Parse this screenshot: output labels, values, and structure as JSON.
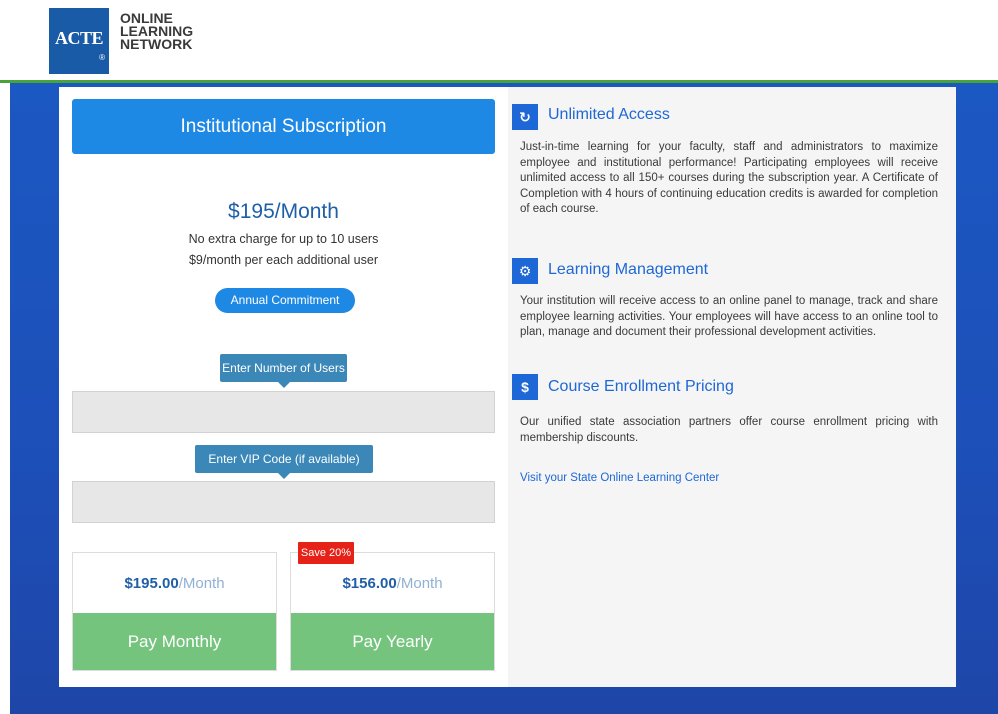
{
  "header": {
    "logo_brand": "ACTE",
    "logo_mark": "®",
    "logo_lines": [
      "ONLINE",
      "LEARNING",
      "NETWORK"
    ]
  },
  "subscription": {
    "title": "Institutional Subscription",
    "price": "$195/Month",
    "line1": "No extra charge for up to 10 users",
    "line2": "$9/month per each additional user",
    "commitment_label": "Annual Commitment",
    "users_label": "Enter Number of Users",
    "users_value": "",
    "vip_label": "Enter VIP Code (if available)",
    "vip_value": ""
  },
  "plans": [
    {
      "amount": "$195.00",
      "unit": "/Month",
      "button": "Pay Monthly"
    },
    {
      "amount": "$156.00",
      "unit": "/Month",
      "button": "Pay Yearly",
      "badge": "Save 20%"
    }
  ],
  "info": {
    "sections": [
      {
        "icon": "refresh-icon",
        "glyph": "↻",
        "title": "Unlimited Access",
        "body": "Just-in-time learning for your faculty, staff and administrators to maximize employee and institutional performance! Participating employees will receive unlimited access to all 150+ courses during the subscription year. A Certificate of Completion with 4 hours of continuing education credits is awarded for completion of each course."
      },
      {
        "icon": "gears-icon",
        "glyph": "⚙",
        "title": "Learning Management",
        "body": "Your institution will receive access to an online panel to manage, track and share employee learning activities. Your employees will have access to an online tool to plan, manage and document their professional development activities."
      },
      {
        "icon": "dollar-icon",
        "glyph": "$",
        "title": "Course Enrollment Pricing",
        "body": "Our unified state association partners offer course enrollment pricing with membership discounts."
      }
    ],
    "link_text": "Visit your State Online Learning Center"
  },
  "colors": {
    "accent_blue": "#1e88e5",
    "header_green": "#49a33b",
    "pay_green": "#75c47e",
    "badge_red": "#e62117"
  }
}
